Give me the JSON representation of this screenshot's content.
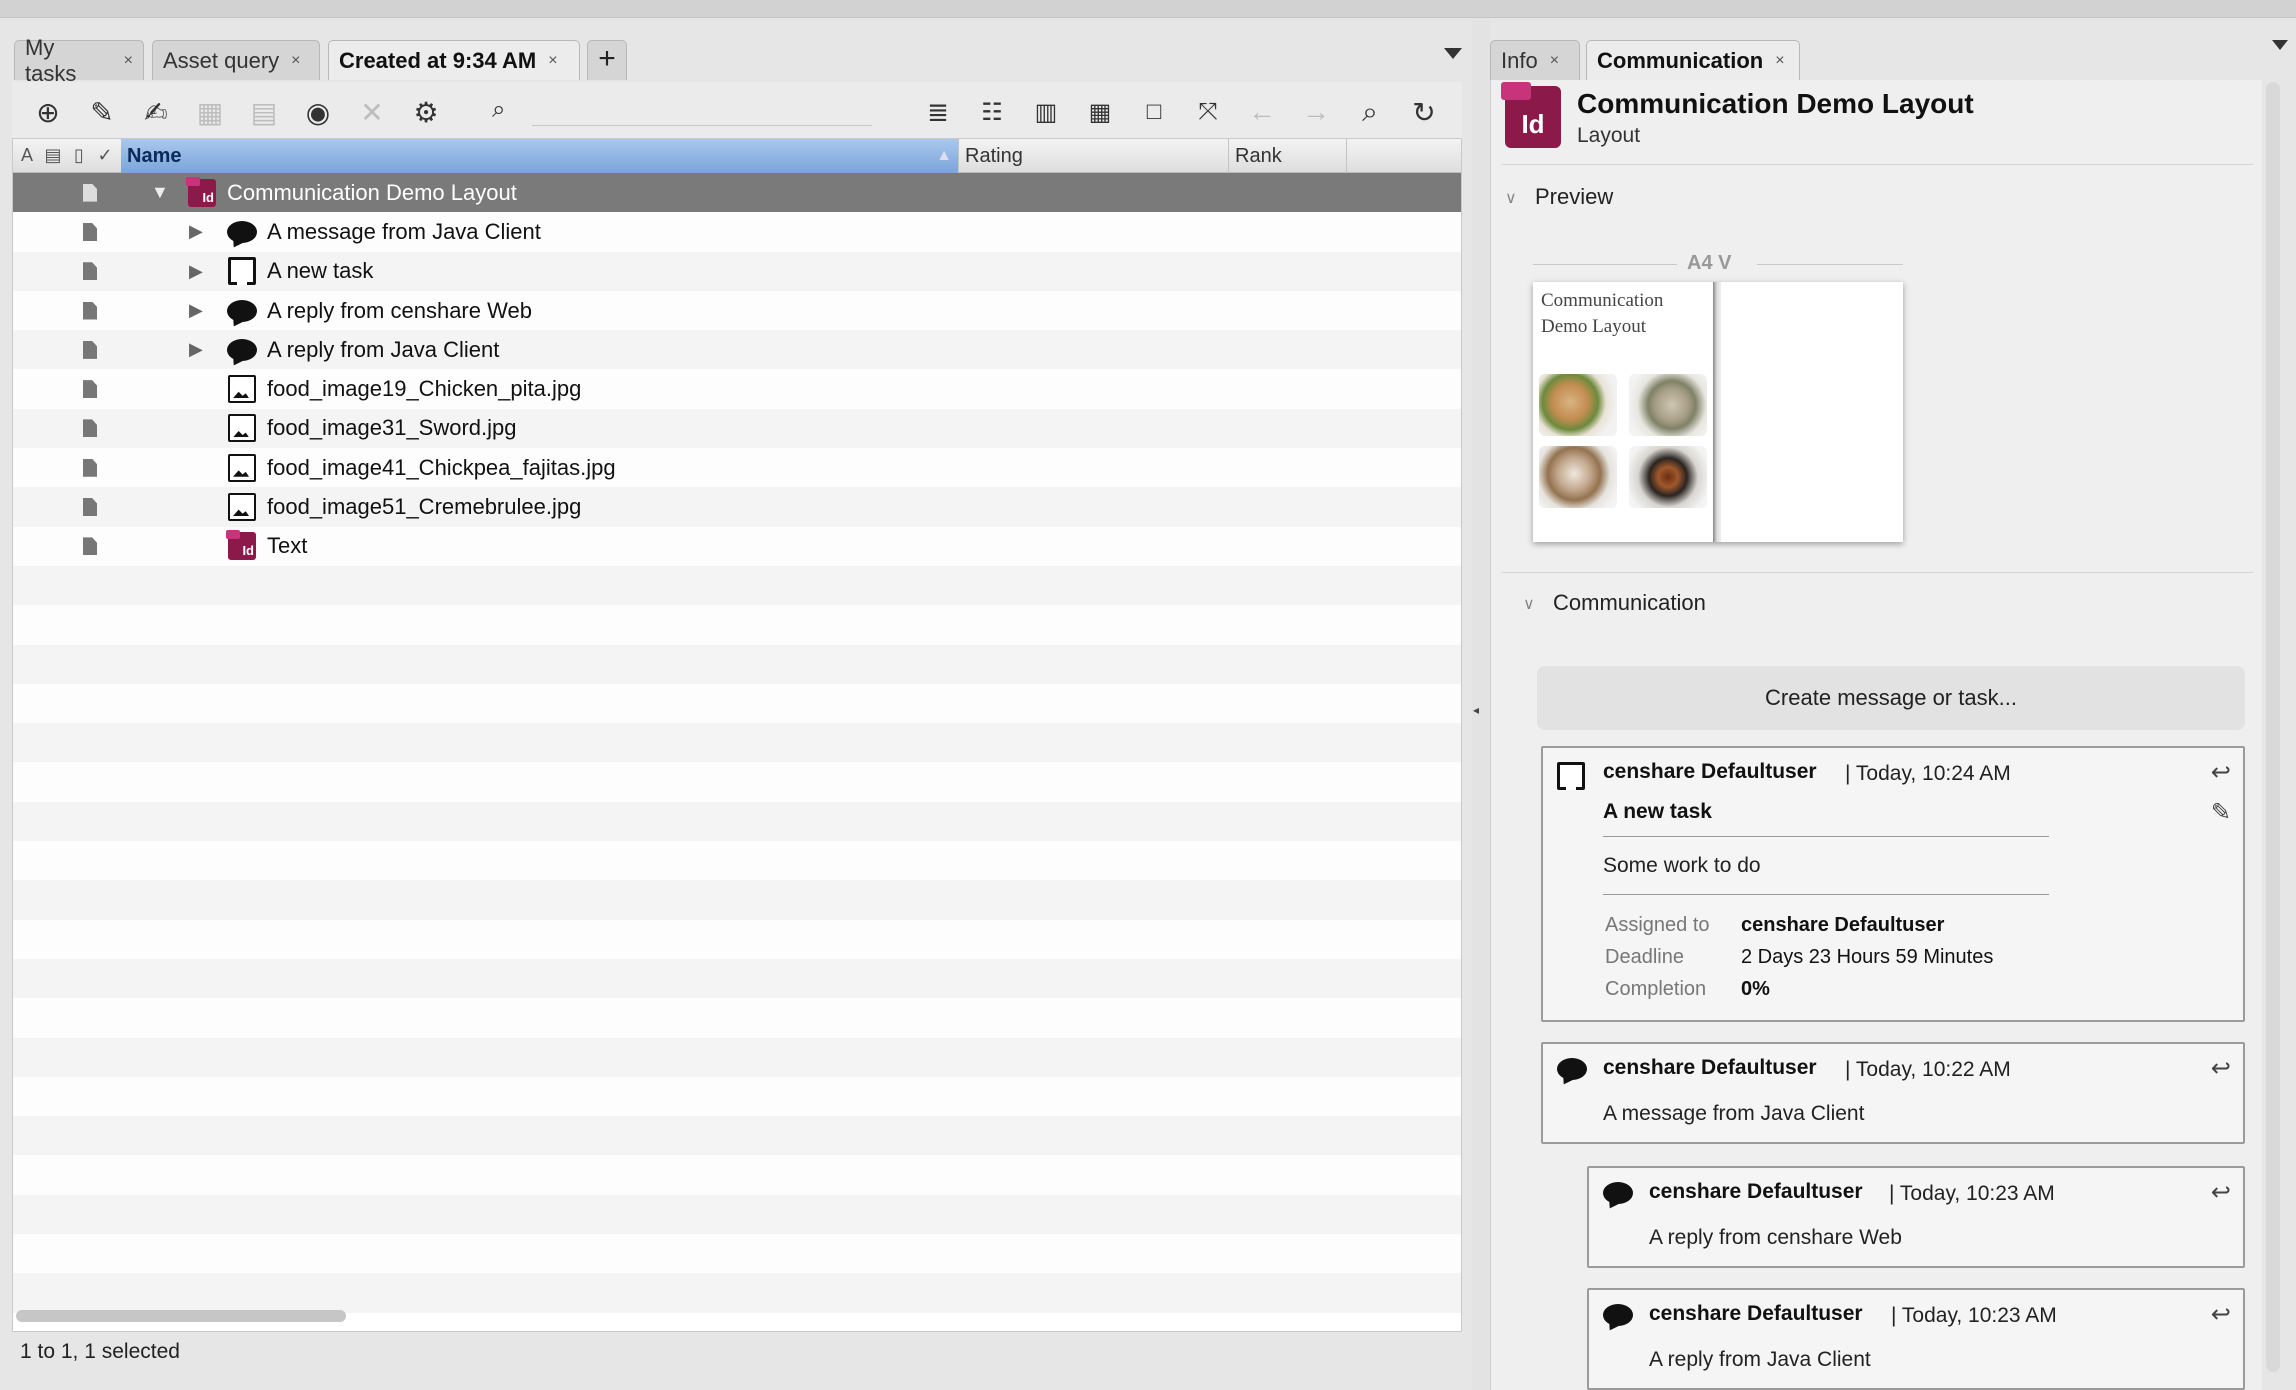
{
  "left_tabs": [
    {
      "label": "My tasks"
    },
    {
      "label": "Asset query"
    },
    {
      "label": "Created at 9:34 AM"
    }
  ],
  "right_tabs": [
    {
      "label": "Info"
    },
    {
      "label": "Communication"
    }
  ],
  "close_glyph": "×",
  "add_tab_glyph": "+",
  "search": {
    "value": "",
    "placeholder": ""
  },
  "columns": {
    "name": "Name",
    "rating": "Rating",
    "rank": "Rank"
  },
  "tree": {
    "root": "Communication Demo Layout",
    "children": [
      {
        "label": "A message from Java Client",
        "icon": "message-bubble-icon"
      },
      {
        "label": "A new task",
        "icon": "task-icon"
      },
      {
        "label": "A reply from censhare Web",
        "icon": "message-bubble-icon"
      },
      {
        "label": "A reply from Java Client",
        "icon": "message-bubble-icon"
      },
      {
        "label": "food_image19_Chicken_pita.jpg",
        "icon": "image-icon"
      },
      {
        "label": "food_image31_Sword.jpg",
        "icon": "image-icon"
      },
      {
        "label": "food_image41_Chickpea_fajitas.jpg",
        "icon": "image-icon"
      },
      {
        "label": "food_image51_Cremebrulee.jpg",
        "icon": "image-icon"
      },
      {
        "label": "Text",
        "icon": "indesign-text-icon"
      }
    ]
  },
  "status": "1 to 1, 1 selected",
  "header": {
    "title": "Communication Demo Layout",
    "subtitle": "Layout",
    "icon_text": "Id",
    "small_icon_text": "Id"
  },
  "preview": {
    "section_label": "Preview",
    "format_label": "A4 V",
    "page_title_line1": "Communication",
    "page_title_line2": "Demo Layout"
  },
  "communication": {
    "section_label": "Communication",
    "create_button": "Create message or task...",
    "task": {
      "user": "censhare Defaultuser",
      "time": "| Today, 10:24 AM",
      "title": "A new task",
      "body": "Some work to do",
      "assigned_label": "Assigned to",
      "assigned_value": "censhare Defaultuser",
      "deadline_label": "Deadline",
      "deadline_value": "2 Days 23 Hours 59 Minutes",
      "completion_label": "Completion",
      "completion_value": "0%"
    },
    "messages": [
      {
        "user": "censhare Defaultuser",
        "time": "| Today, 10:22 AM",
        "text": "A message from Java Client"
      },
      {
        "user": "censhare Defaultuser",
        "time": "| Today, 10:23 AM",
        "text": "A reply from censhare Web"
      },
      {
        "user": "censhare Defaultuser",
        "time": "| Today, 10:23 AM",
        "text": "A reply from Java Client"
      }
    ]
  },
  "colors": {
    "selection": "#7a7a7a",
    "name_header": "#7ba4d8",
    "indesign": "#8b1a4a"
  }
}
